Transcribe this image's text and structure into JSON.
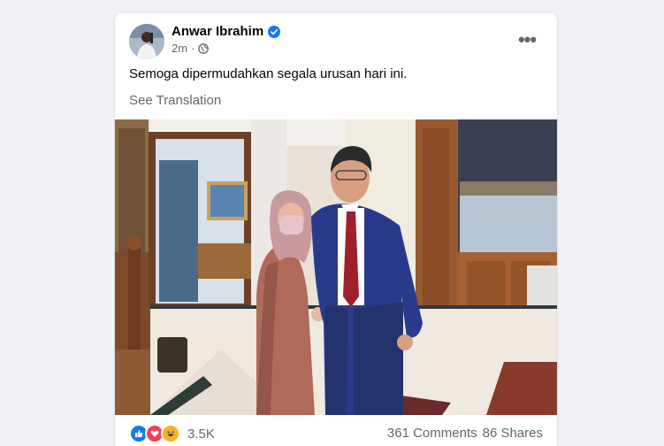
{
  "post": {
    "author": "Anwar Ibrahim",
    "time": "2m",
    "privacy_icon": "globe-icon",
    "verified_icon": "verified-badge-icon",
    "text": "Semoga dipermudahkan segala urusan hari ini.",
    "see_translation": "See Translation",
    "more_label": "•••"
  },
  "footer": {
    "reaction_icons": [
      "like-icon",
      "love-icon",
      "haha-icon"
    ],
    "reaction_count": "3.5K",
    "comments": "361 Comments",
    "shares": "86 Shares"
  },
  "colors": {
    "like": "#1877f2",
    "love": "#f33e58",
    "haha": "#f7b125",
    "verified": "#1877f2"
  }
}
